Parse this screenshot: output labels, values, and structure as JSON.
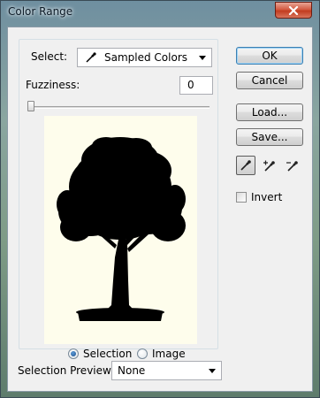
{
  "window": {
    "title": "Color Range"
  },
  "select": {
    "label": "Select:",
    "value": "Sampled Colors",
    "icon": "eyedropper-icon"
  },
  "fuzziness": {
    "label": "Fuzziness:",
    "value": "0",
    "slider_fraction": 0.0
  },
  "view_mode": {
    "options": [
      {
        "label": "Selection",
        "selected": true
      },
      {
        "label": "Image",
        "selected": false
      }
    ]
  },
  "buttons": {
    "ok": "OK",
    "cancel": "Cancel",
    "load": "Load...",
    "save": "Save..."
  },
  "eyedropper_tools": [
    {
      "icon": "eyedropper-icon",
      "active": true
    },
    {
      "icon": "eyedropper-add-icon",
      "active": false
    },
    {
      "icon": "eyedropper-subtract-icon",
      "active": false
    }
  ],
  "invert": {
    "label": "Invert",
    "checked": false
  },
  "selection_preview": {
    "label": "Selection Preview:",
    "value": "None"
  },
  "colors": {
    "preview_bg": "#fefdec",
    "tree": "#000000",
    "default_button_border": "#3c7fb1"
  }
}
